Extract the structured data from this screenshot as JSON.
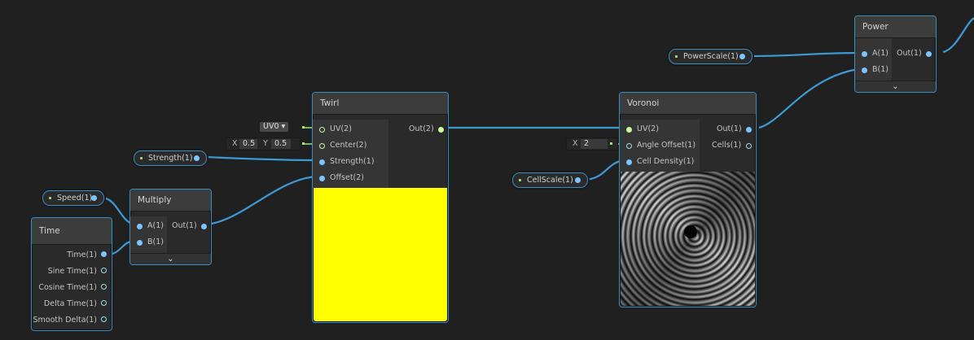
{
  "nodes": {
    "power": {
      "title": "Power",
      "in_a": "A(1)",
      "in_b": "B(1)",
      "out": "Out(1)"
    },
    "twirl": {
      "title": "Twirl",
      "in_uv": "UV(2)",
      "in_center": "Center(2)",
      "in_strength": "Strength(1)",
      "in_offset": "Offset(2)",
      "out": "Out(2)",
      "preview_color": "#ffff00"
    },
    "voronoi": {
      "title": "Voronoi",
      "in_uv": "UV(2)",
      "in_angle": "Angle Offset(1)",
      "in_density": "Cell Density(1)",
      "out": "Out(1)",
      "cells": "Cells(1)"
    },
    "multiply": {
      "title": "Multiply",
      "in_a": "A(1)",
      "in_b": "B(1)",
      "out": "Out(1)"
    },
    "time": {
      "title": "Time",
      "outputs": [
        "Time(1)",
        "Sine Time(1)",
        "Cosine Time(1)",
        "Delta Time(1)",
        "Smooth Delta(1)"
      ]
    }
  },
  "properties": {
    "power_scale": "PowerScale(1)",
    "strength": "Strength(1)",
    "speed": "Speed(1)",
    "cell_scale": "CellScale(1)"
  },
  "inline_inputs": {
    "uv_channel": "UV0",
    "center_x_label": "X",
    "center_x": "0.5",
    "center_y_label": "Y",
    "center_y": "0.5",
    "angle_x_label": "X",
    "angle_x": "2"
  },
  "colors": {
    "wire": "#3b8ec4",
    "accent": "#7cc6ff",
    "background": "#202020"
  }
}
